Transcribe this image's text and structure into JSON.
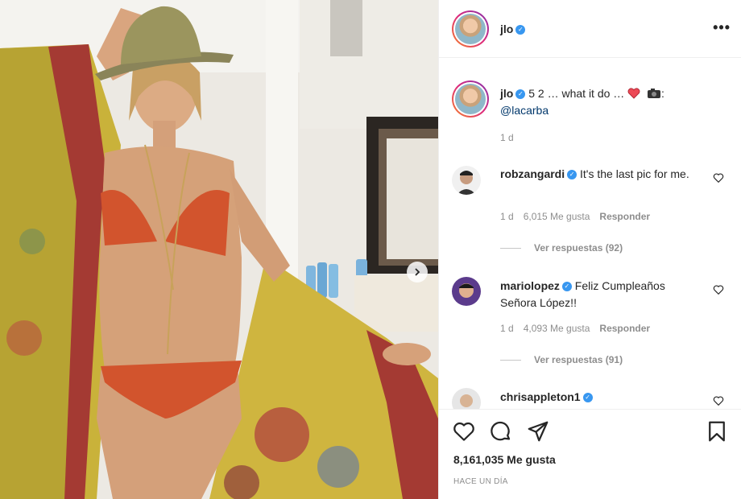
{
  "post": {
    "username": "jlo",
    "caption_text": "5 2 … what it do … ",
    "caption_emojis": [
      "red-heart",
      "camera"
    ],
    "caption_colon": ":",
    "caption_mention": "@lacarba",
    "caption_time": "1 d"
  },
  "comments": [
    {
      "username": "robzangardi",
      "text": "It's the last pic for me.",
      "time": "1 d",
      "likes": "6,015 Me gusta",
      "reply_label": "Responder",
      "view_replies": "Ver respuestas (92)"
    },
    {
      "username": "mariolopez",
      "text": "Feliz Cumpleaños Señora López!!",
      "time": "1 d",
      "likes": "4,093 Me gusta",
      "reply_label": "Responder",
      "view_replies": "Ver respuestas (91)"
    },
    {
      "username": "chrisappleton1",
      "text": "",
      "time": "",
      "likes": "",
      "reply_label": "",
      "view_replies": ""
    }
  ],
  "actions": {
    "icons": [
      "heart-icon",
      "comment-icon",
      "share-icon",
      "bookmark-icon"
    ],
    "likes_count": "8,161,035 Me gusta",
    "posted_ago": "HACE UN DÍA"
  },
  "colors": {
    "verified": "#3897f0",
    "heart": "#ed4956",
    "mention": "#00376b",
    "muted": "#8e8e8e"
  }
}
